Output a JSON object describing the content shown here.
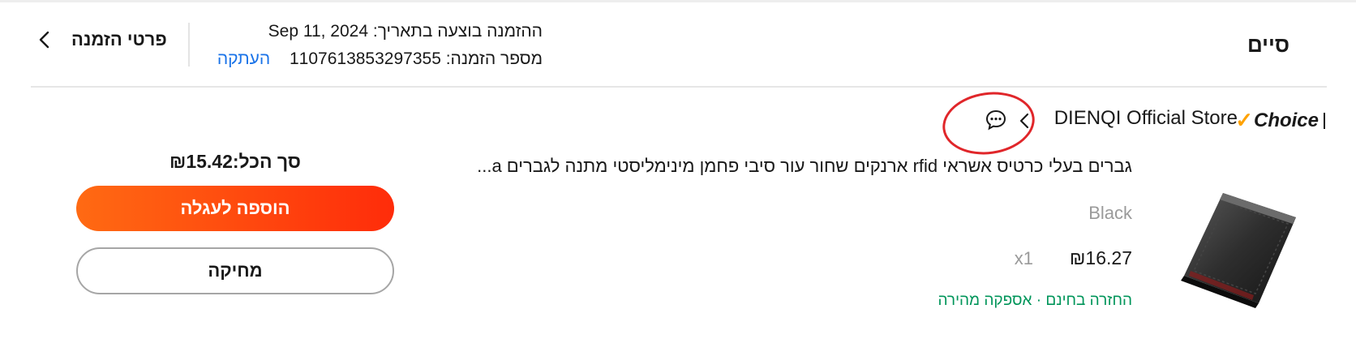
{
  "header": {
    "status": "סיים",
    "order_date_label": "ההזמנה בוצעה בתאריך:",
    "order_date": "Sep 11, 2024",
    "order_number_label": "מספר הזמנה:",
    "order_number": "1107613853297355",
    "copy_label": "העתקה",
    "details_label": "פרטי הזמנה"
  },
  "store": {
    "choice_badge": "Choice",
    "name": "DIENQI Official Store"
  },
  "product": {
    "title": "גברים בעלי כרטיס אשראי rfid ארנקים שחור עור סיבי פחמן מינימליסטי מתנה לגברים a...",
    "variant": "Black",
    "price": "₪16.27",
    "quantity": "x1",
    "badges": "החזרה בחינם · אספקה מהירה"
  },
  "summary": {
    "total": "סך הכל:₪15.42",
    "add_to_cart_label": "הוספה לעגלה",
    "delete_label": "מחיקה"
  },
  "colors": {
    "accent_orange": "#ff4a0c",
    "success_green": "#00955a",
    "link_blue": "#1a73e8",
    "annotation_red": "#e0262a",
    "choice_gold": "#ffa200"
  },
  "icons": [
    "chevron-left-icon",
    "chevron-left-icon",
    "chat-bubble-icon",
    "wallet-product-image"
  ]
}
